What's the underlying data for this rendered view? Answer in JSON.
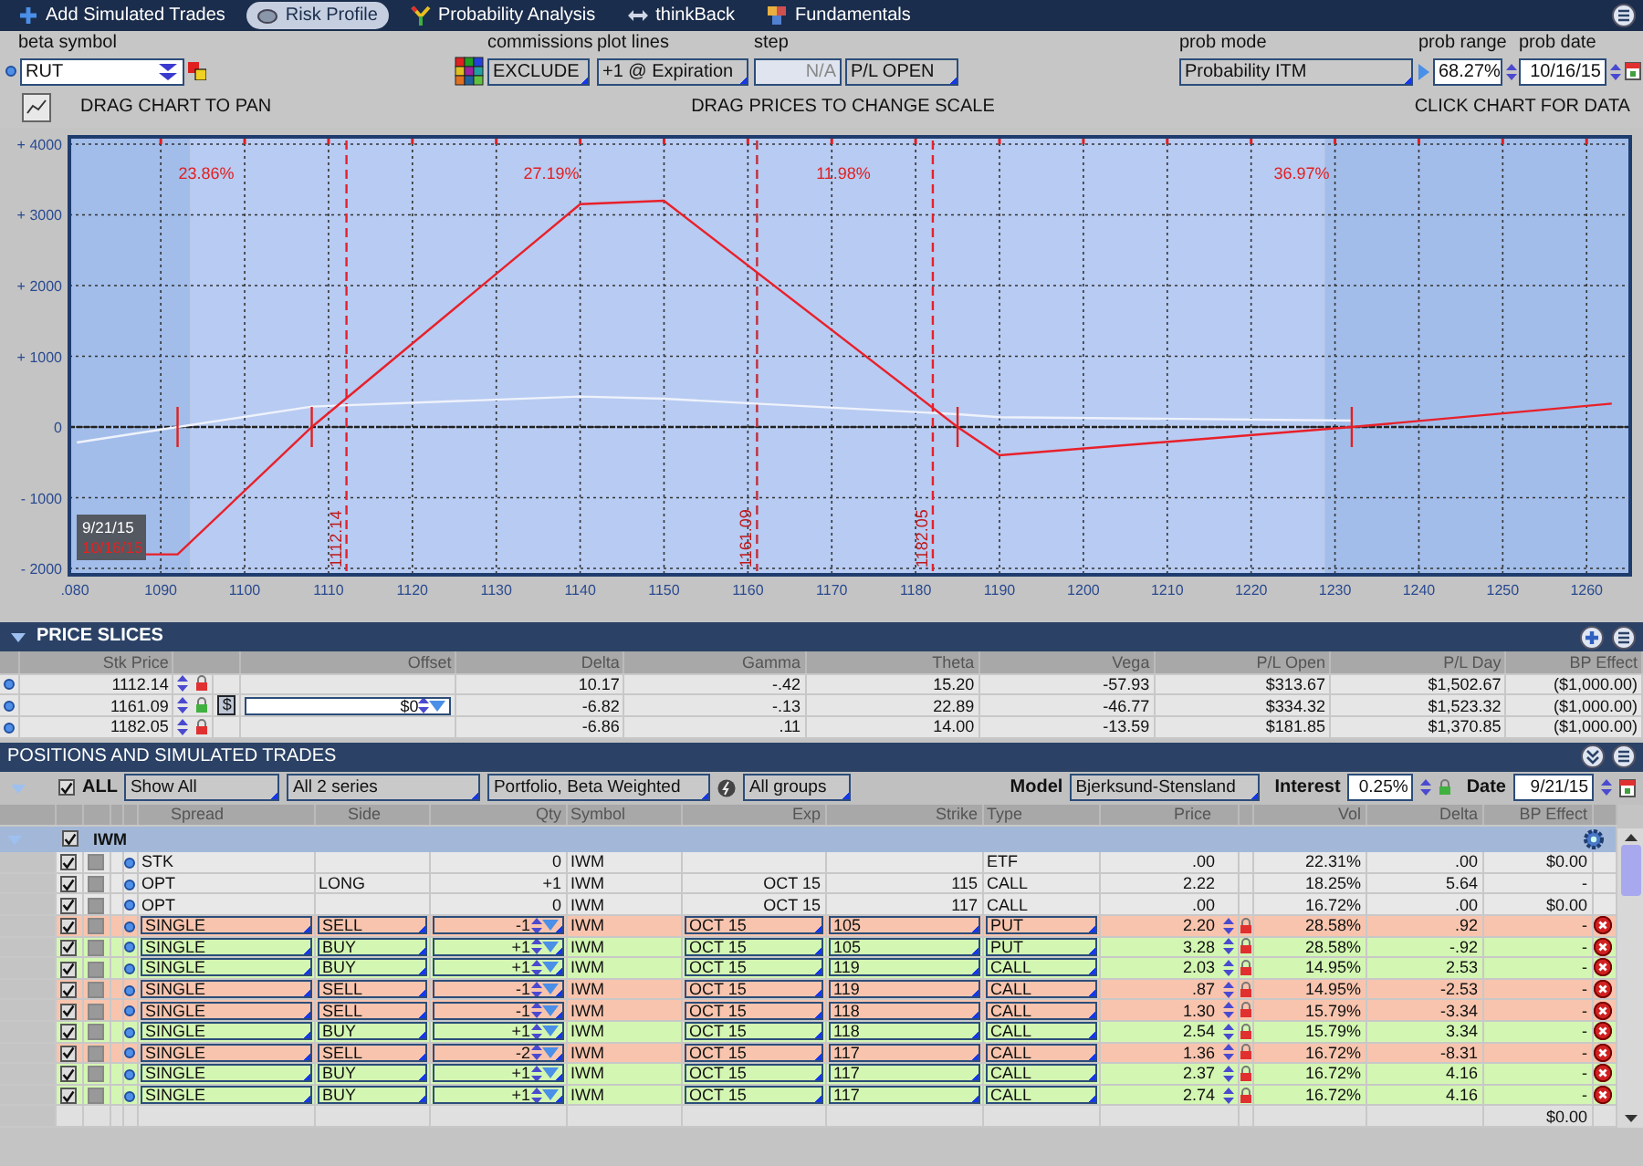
{
  "tabs": [
    {
      "label": "Add Simulated Trades",
      "selected": false
    },
    {
      "label": "Risk Profile",
      "selected": true
    },
    {
      "label": "Probability Analysis",
      "selected": false
    },
    {
      "label": "thinkBack",
      "selected": false
    },
    {
      "label": "Fundamentals",
      "selected": false
    }
  ],
  "controls": {
    "beta_symbol": {
      "label": "beta symbol",
      "value": "RUT"
    },
    "commissions": {
      "label": "commissions",
      "value": "EXCLUDE"
    },
    "plot_lines": {
      "label": "plot lines",
      "value": "+1 @ Expiration"
    },
    "step": {
      "label": "step",
      "value": "N/A",
      "disabled": true,
      "mode": "P/L OPEN"
    },
    "prob_mode": {
      "label": "prob mode",
      "value": "Probability ITM"
    },
    "prob_range": {
      "label": "prob range",
      "value": "68.27%"
    },
    "prob_date": {
      "label": "prob date",
      "value": "10/16/15"
    }
  },
  "chart_hints": [
    "DRAG CHART TO PAN",
    "DRAG PRICES TO CHANGE SCALE",
    "CLICK CHART FOR DATA"
  ],
  "chart": {
    "chart_data": {
      "type": "line",
      "x": [
        1080,
        1092,
        1108,
        1140,
        1150,
        1185,
        1190,
        1232,
        1263
      ],
      "series": [
        {
          "color": "#e8202a",
          "values": [
            -1800,
            -1800,
            0,
            3150,
            3200,
            0,
            -400,
            0,
            330
          ]
        },
        {
          "color": "#eef2fb",
          "values": [
            -220,
            0,
            290,
            430,
            400,
            180,
            140,
            90,
            null
          ]
        }
      ],
      "xlim": [
        1079.1,
        1265.2
      ],
      "ylim": [
        -2090,
        4103
      ],
      "xticks": [
        1090,
        1100,
        1110,
        1120,
        1130,
        1140,
        1150,
        1160,
        1170,
        1180,
        1190,
        1200,
        1210,
        1220,
        1230,
        1240,
        1250,
        1260
      ],
      "yticks": [
        {
          "value": 4000,
          "label": "+ 4000"
        },
        {
          "value": 3000,
          "label": "+ 3000"
        },
        {
          "value": 2000,
          "label": "+ 2000"
        },
        {
          "value": 1000,
          "label": "+ 1000"
        },
        0,
        {
          "value": -1000,
          "label": "- 1000"
        },
        {
          "value": -2000,
          "label": "- 2000"
        }
      ],
      "grid": true,
      "ref_lines": [
        {
          "axis": "y",
          "value": 0,
          "color": "#222222"
        },
        {
          "axis": "x",
          "value": 1112.14,
          "label": "1112.14",
          "color": "#e8202a"
        },
        {
          "axis": "x",
          "value": 1161.09,
          "label": "1161.09",
          "color": "#c0303a"
        },
        {
          "axis": "x",
          "value": 1182.05,
          "label": "1182.05",
          "color": "#e8202a"
        }
      ],
      "bands": [
        {
          "axis": "x",
          "from": 1079.1,
          "to": 1093.5,
          "color": "#a2bdea"
        },
        {
          "axis": "x",
          "from": 1228.8,
          "to": 1265.2,
          "color": "#a2bdea"
        }
      ],
      "annotations": [
        "23.86%",
        "27.19%",
        "11.98%",
        "36.97%"
      ]
    },
    "edge_tick_label": ".080",
    "date_box": [
      "9/21/15",
      "10/16/15"
    ]
  },
  "price_slices": {
    "title": "PRICE SLICES",
    "columns": [
      "Stk Price",
      "Offset",
      "Delta",
      "Gamma",
      "Theta",
      "Vega",
      "P/L Open",
      "P/L Day",
      "BP Effect"
    ],
    "rows": [
      {
        "stk_price": "1112.14",
        "locked": true,
        "values": [
          "10.17",
          "-.42",
          "15.20",
          "-57.93",
          "$313.67",
          "$1,502.67",
          "($1,000.00)"
        ]
      },
      {
        "stk_price": "1161.09",
        "locked": false,
        "offset_unit": "$",
        "offset": "$0",
        "values": [
          "-6.82",
          "-.13",
          "22.89",
          "-46.77",
          "$334.32",
          "$1,523.32",
          "($1,000.00)"
        ]
      },
      {
        "stk_price": "1182.05",
        "locked": true,
        "values": [
          "-6.86",
          ".11",
          "14.00",
          "-13.59",
          "$181.85",
          "$1,370.85",
          "($1,000.00)"
        ]
      }
    ]
  },
  "positions": {
    "title": "POSITIONS AND SIMULATED TRADES",
    "all": {
      "label": "ALL",
      "checked": true
    },
    "filters": [
      "Show All",
      "All 2 series",
      "Portfolio, Beta Weighted",
      "All groups"
    ],
    "model": {
      "label": "Model",
      "value": "Bjerksund-Stensland"
    },
    "interest": {
      "label": "Interest",
      "value": "0.25%"
    },
    "date": {
      "label": "Date",
      "value": "9/21/15"
    },
    "columns": [
      "Spread",
      "Side",
      "Qty",
      "Symbol",
      "Exp",
      "Strike",
      "Type",
      "Price",
      "Vol",
      "Delta",
      "BP Effect"
    ],
    "group": {
      "name": "IWM",
      "checked": true,
      "expanded": true
    },
    "rows": [
      {
        "kind": "position",
        "checked": true,
        "spread": "STK",
        "qty": "0",
        "symbol": "IWM",
        "type": "ETF",
        "price": ".00",
        "vol": "22.31%",
        "delta": ".00",
        "bp_effect": "$0.00"
      },
      {
        "kind": "position",
        "checked": true,
        "spread": "OPT",
        "side": "LONG",
        "qty": "+1",
        "symbol": "IWM",
        "exp": "OCT 15",
        "strike": "115",
        "type": "CALL",
        "price": "2.22",
        "vol": "18.25%",
        "delta": "5.64",
        "bp_effect": "-"
      },
      {
        "kind": "position",
        "checked": true,
        "spread": "OPT",
        "qty": "0",
        "symbol": "IWM",
        "exp": "OCT 15",
        "strike": "117",
        "type": "CALL",
        "price": ".00",
        "vol": "16.72%",
        "delta": ".00",
        "bp_effect": "$0.00"
      },
      {
        "kind": "trade",
        "checked": true,
        "color": "#f8c4ae",
        "spread": "SINGLE",
        "side": "SELL",
        "qty": "-1",
        "symbol": "IWM",
        "exp": "OCT 15",
        "strike": "105",
        "type": "PUT",
        "price": "2.20",
        "vol": "28.58%",
        "delta": ".92",
        "bp_effect": "-"
      },
      {
        "kind": "trade",
        "checked": true,
        "color": "#d3f7b2",
        "spread": "SINGLE",
        "side": "BUY",
        "qty": "+1",
        "symbol": "IWM",
        "exp": "OCT 15",
        "strike": "105",
        "type": "PUT",
        "price": "3.28",
        "vol": "28.58%",
        "delta": "-.92",
        "bp_effect": "-"
      },
      {
        "kind": "trade",
        "checked": true,
        "color": "#d3f7b2",
        "spread": "SINGLE",
        "side": "BUY",
        "qty": "+1",
        "symbol": "IWM",
        "exp": "OCT 15",
        "strike": "119",
        "type": "CALL",
        "price": "2.03",
        "vol": "14.95%",
        "delta": "2.53",
        "bp_effect": "-"
      },
      {
        "kind": "trade",
        "checked": true,
        "color": "#f8c4ae",
        "spread": "SINGLE",
        "side": "SELL",
        "qty": "-1",
        "symbol": "IWM",
        "exp": "OCT 15",
        "strike": "119",
        "type": "CALL",
        "price": ".87",
        "vol": "14.95%",
        "delta": "-2.53",
        "bp_effect": "-"
      },
      {
        "kind": "trade",
        "checked": true,
        "color": "#f8c4ae",
        "spread": "SINGLE",
        "side": "SELL",
        "qty": "-1",
        "symbol": "IWM",
        "exp": "OCT 15",
        "strike": "118",
        "type": "CALL",
        "price": "1.30",
        "vol": "15.79%",
        "delta": "-3.34",
        "bp_effect": "-"
      },
      {
        "kind": "trade",
        "checked": true,
        "color": "#d3f7b2",
        "spread": "SINGLE",
        "side": "BUY",
        "qty": "+1",
        "symbol": "IWM",
        "exp": "OCT 15",
        "strike": "118",
        "type": "CALL",
        "price": "2.54",
        "vol": "15.79%",
        "delta": "3.34",
        "bp_effect": "-"
      },
      {
        "kind": "trade",
        "checked": true,
        "color": "#f8c4ae",
        "spread": "SINGLE",
        "side": "SELL",
        "qty": "-2",
        "symbol": "IWM",
        "exp": "OCT 15",
        "strike": "117",
        "type": "CALL",
        "price": "1.36",
        "vol": "16.72%",
        "delta": "-8.31",
        "bp_effect": "-"
      },
      {
        "kind": "trade",
        "checked": true,
        "color": "#d3f7b2",
        "spread": "SINGLE",
        "side": "BUY",
        "qty": "+1",
        "symbol": "IWM",
        "exp": "OCT 15",
        "strike": "117",
        "type": "CALL",
        "price": "2.37",
        "vol": "16.72%",
        "delta": "4.16",
        "bp_effect": "-"
      },
      {
        "kind": "trade",
        "checked": true,
        "color": "#d3f7b2",
        "spread": "SINGLE",
        "side": "BUY",
        "qty": "+1",
        "symbol": "IWM",
        "exp": "OCT 15",
        "strike": "117",
        "type": "CALL",
        "price": "2.74",
        "vol": "16.72%",
        "delta": "4.16",
        "bp_effect": "-"
      }
    ],
    "total": "$0.00"
  }
}
